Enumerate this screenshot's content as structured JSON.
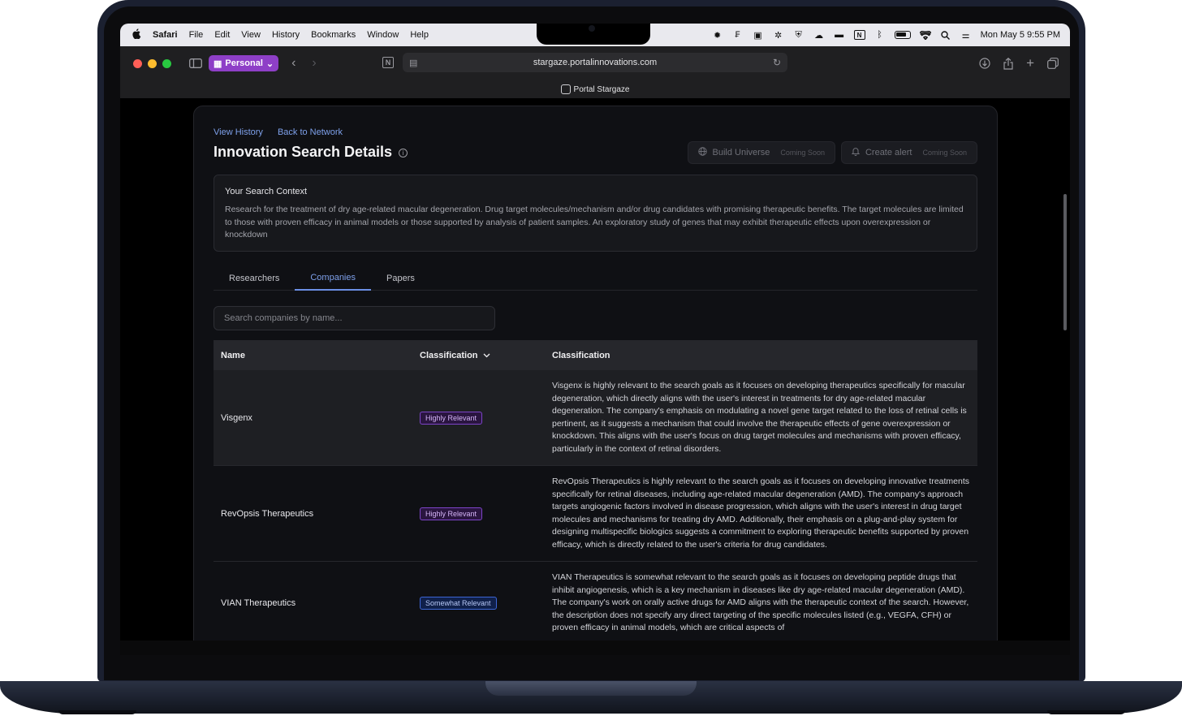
{
  "menubar": {
    "app": "Safari",
    "items": [
      "File",
      "Edit",
      "View",
      "History",
      "Bookmarks",
      "Window",
      "Help"
    ],
    "clock": "Mon May 5  9:55 PM"
  },
  "browser": {
    "profile": "Personal",
    "url": "stargaze.portalinnovations.com",
    "tab_title": "Portal Stargaze"
  },
  "page": {
    "links": {
      "history": "View History",
      "back": "Back to Network"
    },
    "title": "Innovation Search Details",
    "actions": {
      "build": {
        "label": "Build Universe",
        "badge": "Coming Soon"
      },
      "alert": {
        "label": "Create alert",
        "badge": "Coming Soon"
      }
    },
    "context": {
      "title": "Your Search Context",
      "text": "Research for the treatment of dry age-related macular degeneration. Drug target molecules/mechanism and/or drug candidates with promising therapeutic benefits. The target molecules are limited to those with proven efficacy in animal models or those supported by analysis of patient samples. An exploratory study of genes that may exhibit therapeutic effects upon overexpression or knockdown"
    },
    "tabs": [
      "Researchers",
      "Companies",
      "Papers"
    ],
    "search_placeholder": "Search companies by name...",
    "table": {
      "headers": {
        "name": "Name",
        "classification": "Classification",
        "description": "Classification"
      },
      "rows": [
        {
          "name": "Visgenx",
          "badge": "Highly Relevant",
          "description": "Visgenx is highly relevant to the search goals as it focuses on developing therapeutics specifically for macular degeneration, which directly aligns with the user's interest in treatments for dry age-related macular degeneration. The company's emphasis on modulating a novel gene target related to the loss of retinal cells is pertinent, as it suggests a mechanism that could involve the therapeutic effects of gene overexpression or knockdown. This aligns with the user's focus on drug target molecules and mechanisms with proven efficacy, particularly in the context of retinal disorders."
        },
        {
          "name": "RevOpsis Therapeutics",
          "badge": "Highly Relevant",
          "description": "RevOpsis Therapeutics is highly relevant to the search goals as it focuses on developing innovative treatments specifically for retinal diseases, including age-related macular degeneration (AMD). The company's approach targets angiogenic factors involved in disease progression, which aligns with the user's interest in drug target molecules and mechanisms for treating dry AMD. Additionally, their emphasis on a plug-and-play system for designing multispecific biologics suggests a commitment to exploring therapeutic benefits supported by proven efficacy, which is directly related to the user's criteria for drug candidates."
        },
        {
          "name": "VIAN Therapeutics",
          "badge": "Somewhat Relevant",
          "description": "VIAN Therapeutics is somewhat relevant to the search goals as it focuses on developing peptide drugs that inhibit angiogenesis, which is a key mechanism in diseases like dry age-related macular degeneration (AMD). The company's work on orally active drugs for AMD aligns with the therapeutic context of the search. However, the description does not specify any direct targeting of the specific molecules listed (e.g., VEGFA, CFH) or proven efficacy in animal models, which are critical aspects of"
        }
      ]
    }
  },
  "colors": {
    "accent": "#7ea0ea",
    "profile": "#8e3fc7",
    "badge_high": "#7d44c8",
    "badge_some": "#3d66d6"
  }
}
